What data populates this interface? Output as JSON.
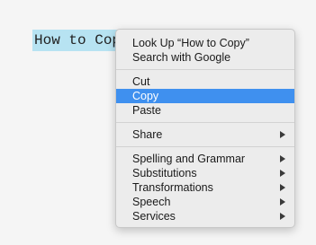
{
  "selection": {
    "text": "How to Copy"
  },
  "context_menu": {
    "lookup_label": "Look Up “How to Copy”",
    "search_label": "Search with Google",
    "cut_label": "Cut",
    "copy_label": "Copy",
    "paste_label": "Paste",
    "share_label": "Share",
    "spelling_label": "Spelling and Grammar",
    "substitutions_label": "Substitutions",
    "transformations_label": "Transformations",
    "speech_label": "Speech",
    "services_label": "Services",
    "highlighted_item": "Copy",
    "highlight_color": "#3f90ef",
    "selection_color": "#b7e3f2"
  }
}
